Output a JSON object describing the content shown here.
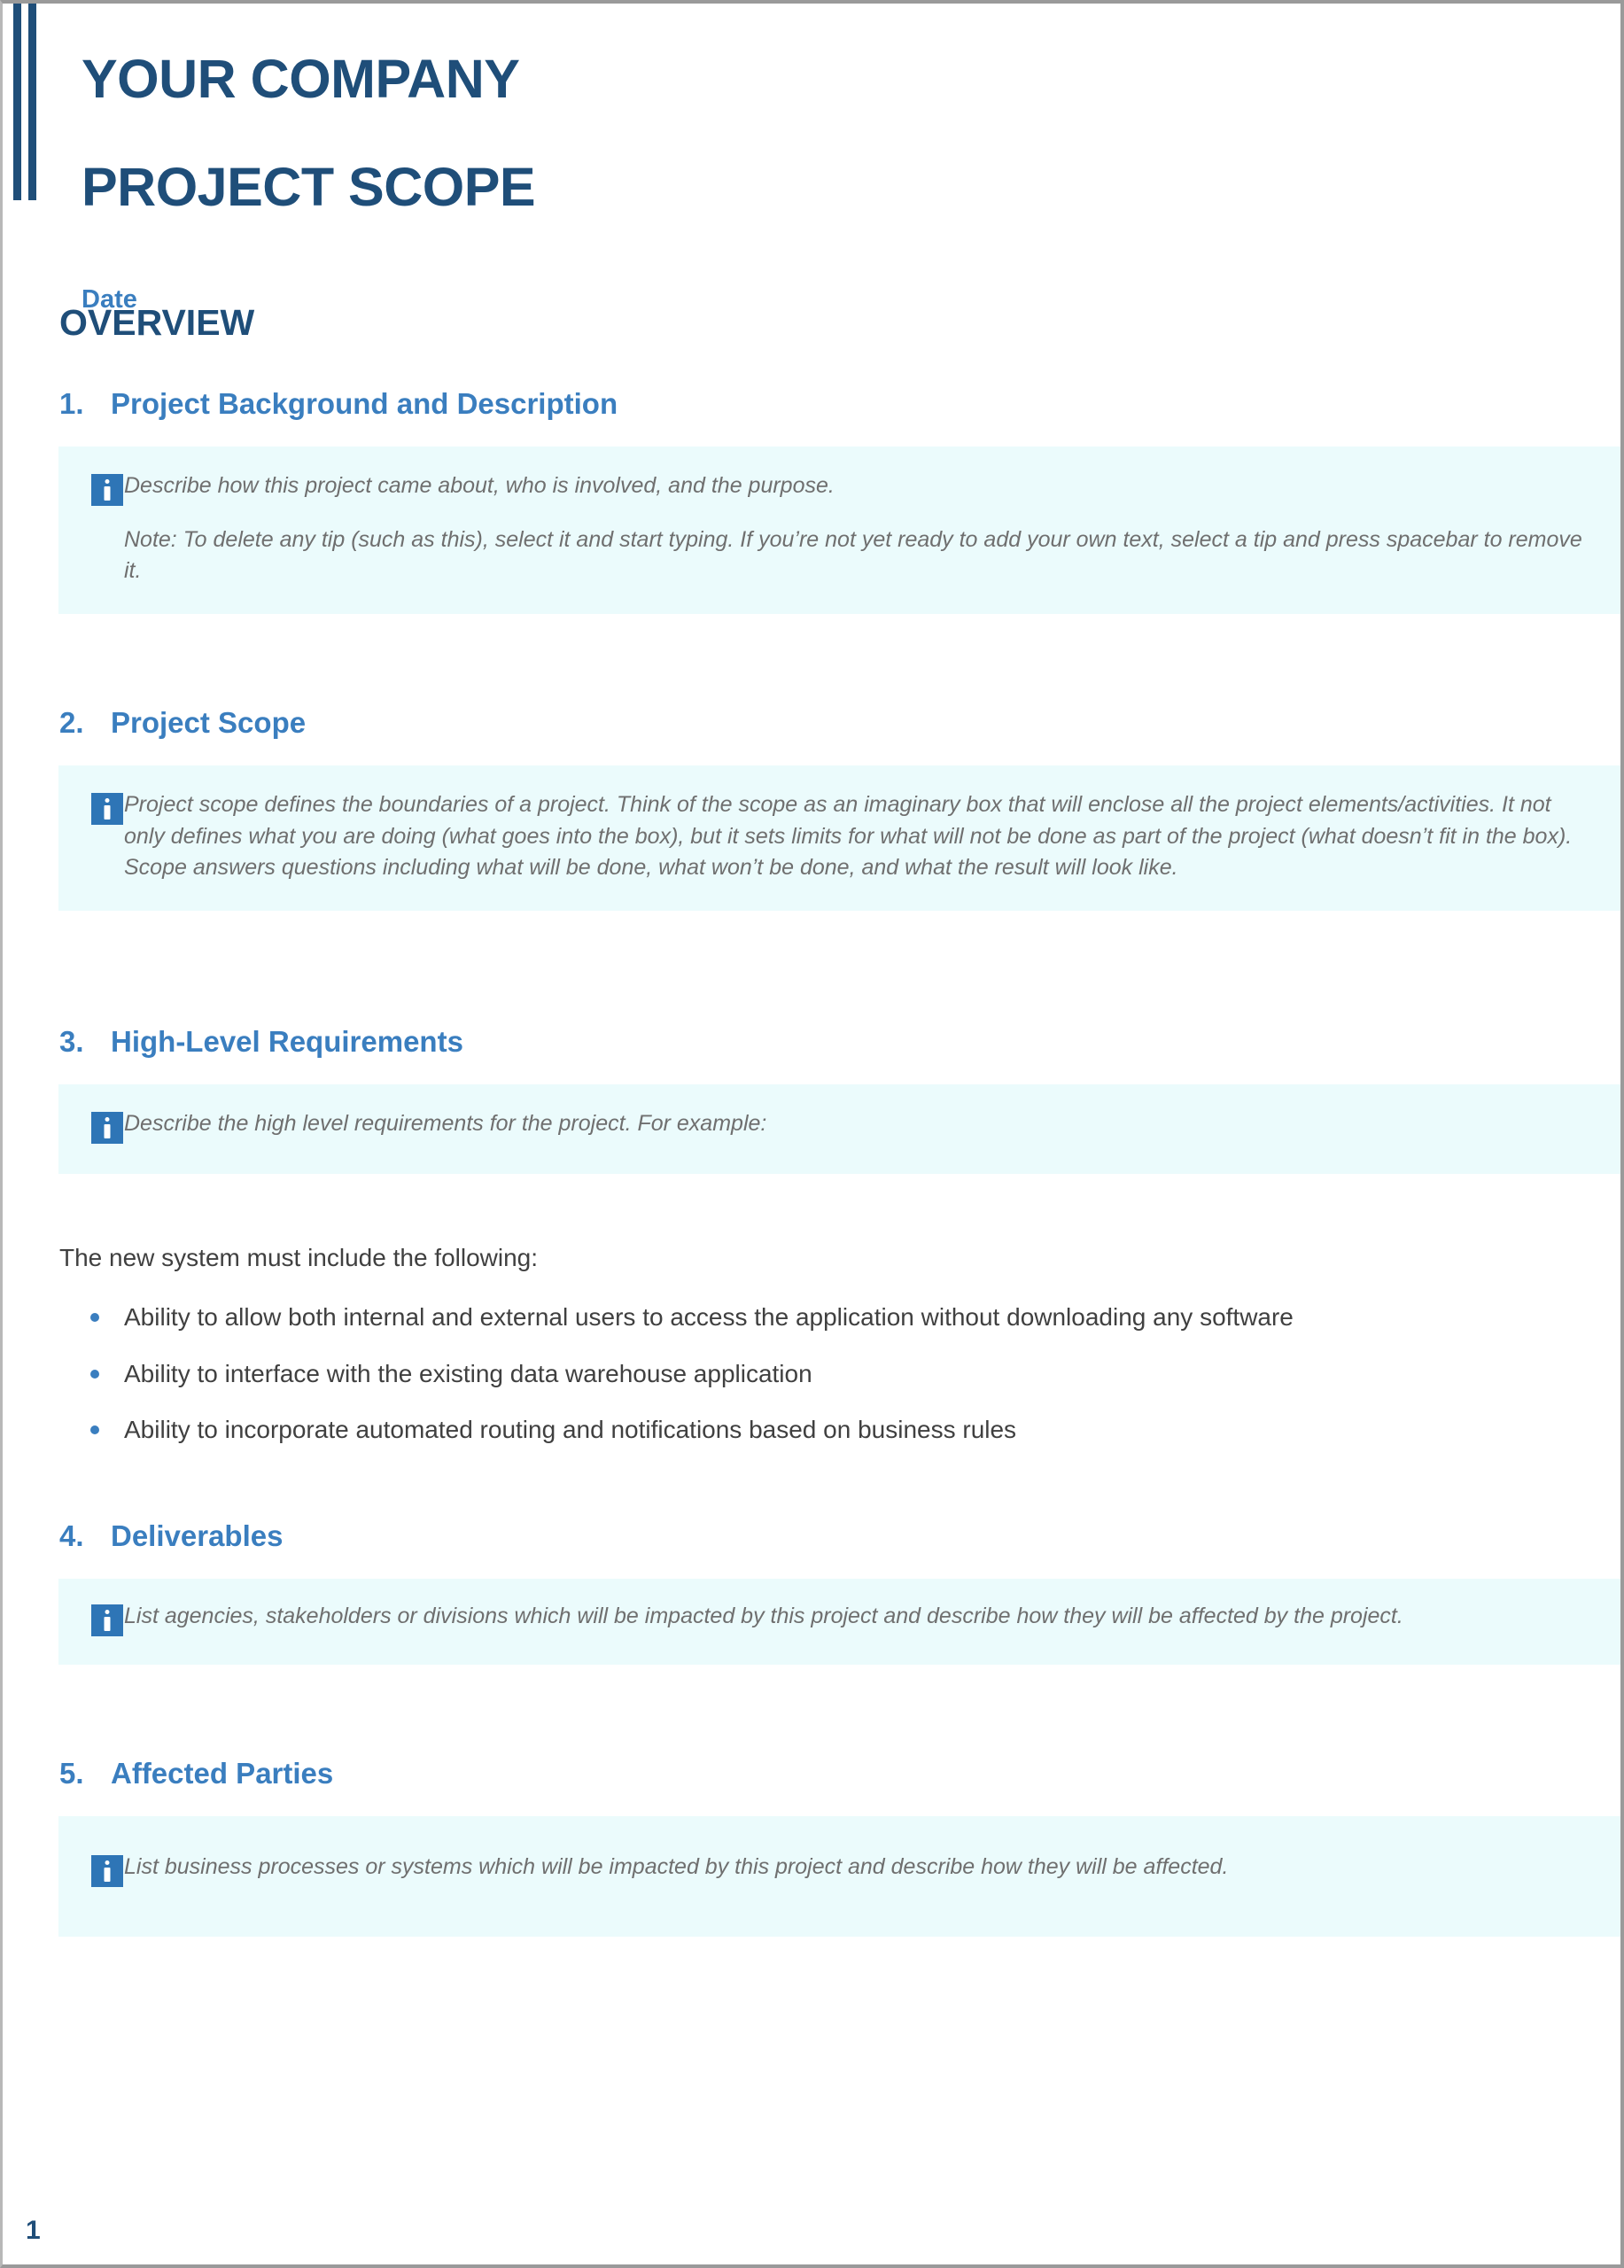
{
  "document": {
    "header": {
      "company_title_line1": "YOUR COMPANY",
      "company_title_line2": "PROJECT SCOPE",
      "date_label": "Date"
    },
    "overview_heading": "OVERVIEW",
    "sections": [
      {
        "number": "1.",
        "title": "Project Background and Description",
        "tip_paragraphs": [
          "Describe how this project came about, who is involved, and the purpose.",
          "Note: To delete any tip (such as this), select it and start typing. If you’re not yet ready to add your own text, select a tip and press spacebar to remove it."
        ]
      },
      {
        "number": "2.",
        "title": "Project Scope",
        "tip_paragraphs": [
          "Project scope defines the boundaries of a project. Think of the scope as an imaginary box that will enclose all the project elements/activities. It not only defines what you are doing (what goes into the box), but it sets limits for what will not be done as part of the project (what doesn’t fit in the box). Scope answers questions including what will be done, what won’t be done, and what the result will look like."
        ]
      },
      {
        "number": "3.",
        "title": "High-Level Requirements",
        "tip_paragraphs": [
          "Describe the high level requirements for the project. For example:"
        ],
        "body_paragraph": "The new system must include the following:",
        "bullets": [
          "Ability to allow both internal and external users to access the application without downloading any software",
          "Ability to interface with the existing data warehouse application",
          "Ability to incorporate automated routing and notifications based on business rules"
        ]
      },
      {
        "number": "4.",
        "title": "Deliverables",
        "tip_paragraphs": [
          "List agencies, stakeholders or divisions which will be impacted by this project and describe how they will be affected by the project."
        ]
      },
      {
        "number": "5.",
        "title": "Affected Parties",
        "tip_paragraphs": [
          "List business processes or systems which will be impacted by this project and describe how they will be affected."
        ]
      }
    ],
    "footer": {
      "page_number": "1"
    },
    "icons": {
      "tip": "info-icon"
    },
    "colors": {
      "header_dark_blue": "#1f4e79",
      "heading_blue": "#3a7ebf",
      "tip_background": "#ebfbfc",
      "tip_icon_blue": "#2e75b6",
      "body_text": "#404040",
      "tip_text": "#6f6f6f"
    }
  }
}
